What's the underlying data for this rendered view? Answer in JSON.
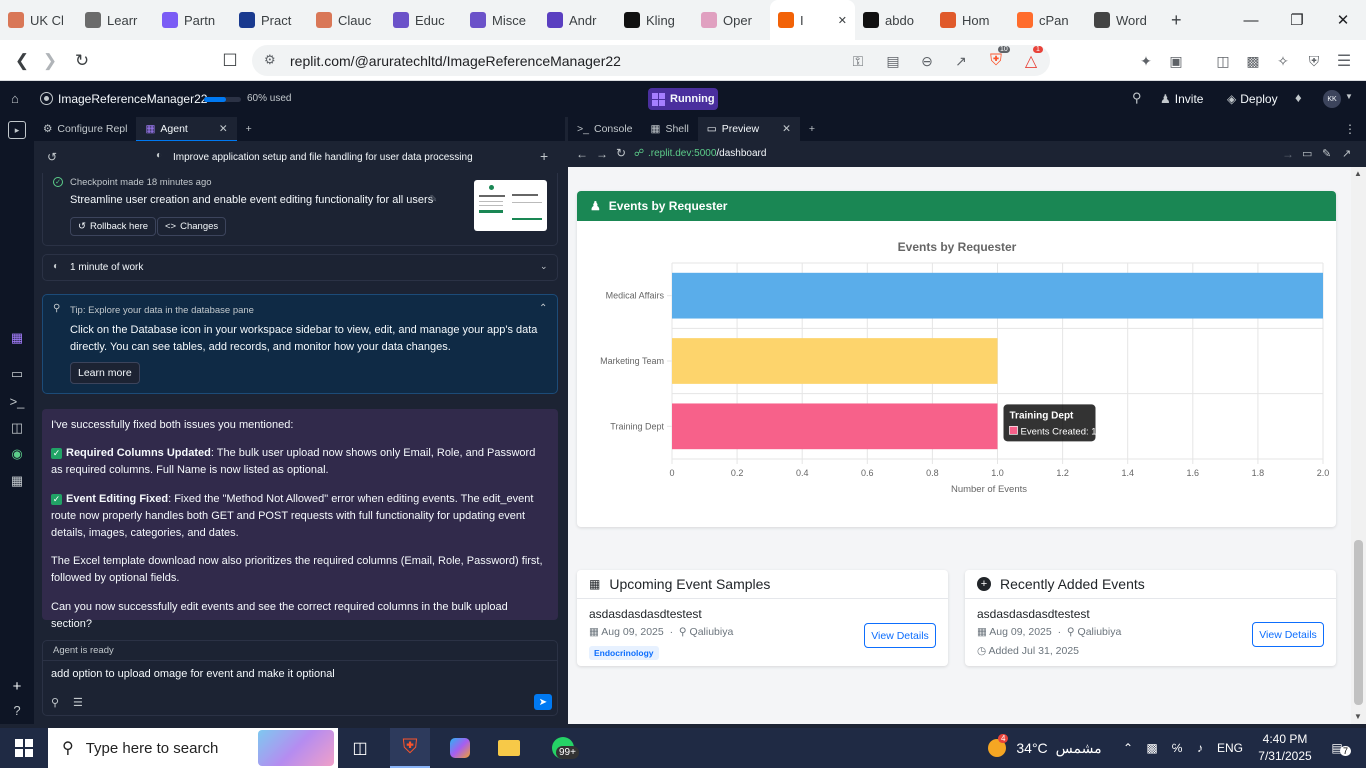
{
  "browser": {
    "tabs": [
      {
        "label": "UK Cl",
        "color": "#d97757"
      },
      {
        "label": "Learr",
        "color": "#6b6b6b"
      },
      {
        "label": "Partn",
        "color": "#7b5cf5"
      },
      {
        "label": "Pract",
        "color": "#1a3a8f"
      },
      {
        "label": "Clauc",
        "color": "#d97757"
      },
      {
        "label": "Educ",
        "color": "#6b52c9"
      },
      {
        "label": "Misce",
        "color": "#6b52c9"
      },
      {
        "label": "Andr",
        "color": "#5a3fc0"
      },
      {
        "label": "Kling",
        "color": "#111111"
      },
      {
        "label": "Oper",
        "color": "#e0a0c0"
      },
      {
        "label": "I",
        "color": "#f26207"
      },
      {
        "label": "abdo",
        "color": "#111111"
      },
      {
        "label": "Hom",
        "color": "#e05a2b"
      },
      {
        "label": "cPan",
        "color": "#ff6c2c"
      },
      {
        "label": "Word",
        "color": "#444444"
      }
    ],
    "active_tab_index": 10,
    "url": "replit.com/@aruratechltd/ImageReferenceManager22",
    "brave_badge": "10",
    "alert_badge": "1"
  },
  "replit": {
    "project_name": "ImageReferenceManager22",
    "usage": "60% used",
    "usage_pct": 60,
    "run_status": "Running",
    "invite": "Invite",
    "deploy": "Deploy",
    "avatar": "KK"
  },
  "left": {
    "tabs": [
      "Configure Repl",
      "Agent"
    ],
    "thread_title": "Improve application setup and file handling for user data processing",
    "checkpoint": {
      "meta": "Checkpoint made 18 minutes ago",
      "title": "Streamline user creation and enable event editing functionality for all users",
      "rollback": "Rollback here",
      "changes": "Changes"
    },
    "work": "1 minute of work",
    "tip": {
      "title": "Tip: Explore your data in the database pane",
      "body": "Click on the Database icon in your workspace sidebar to view, edit, and manage your app's data directly. You can see tables, add records, and monitor how your data changes.",
      "learn_more": "Learn more"
    },
    "message": {
      "intro": "I've successfully fixed both issues you mentioned:",
      "p1_bold": "Required Columns Updated",
      "p1_text": ": The bulk user upload now shows only Email, Role, and Password as required columns. Full Name is now listed as optional.",
      "p2_bold": "Event Editing Fixed",
      "p2_text": ": Fixed the \"Method Not Allowed\" error when editing events. The edit_event route now properly handles both GET and POST requests with full functionality for updating event details, images, categories, and dates.",
      "p3": "The Excel template download now also prioritizes the required columns (Email, Role, Password) first, followed by optional fields.",
      "p4": "Can you now successfully edit events and see the correct required columns in the bulk upload section?"
    },
    "agent_status": "Agent is ready",
    "input_value": "add option to upload omage for event and make it optional"
  },
  "right": {
    "tabs": [
      "Console",
      "Shell",
      "Preview"
    ],
    "preview_url_host": ".replit.dev:5000",
    "preview_url_path": "/dashboard",
    "card_title": "Events by Requester",
    "upcoming_title": "Upcoming Event Samples",
    "recent_title": "Recently Added Events",
    "upcoming_event": {
      "name": "asdasdasdasdtestest",
      "date": "Aug 09, 2025",
      "location": "Qaliubiya",
      "tag": "Endocrinology",
      "button": "View Details"
    },
    "recent_event": {
      "name": "asdasdasdasdtestest",
      "date": "Aug 09, 2025",
      "location": "Qaliubiya",
      "added": "Added Jul 31, 2025",
      "button": "View Details"
    },
    "tooltip": {
      "title": "Training Dept",
      "label": "Events Created: 1"
    }
  },
  "chart_data": {
    "type": "bar",
    "orientation": "horizontal",
    "title": "Events by Requester",
    "xlabel": "Number of Events",
    "ylabel": "",
    "categories": [
      "Medical Affairs",
      "Marketing Team",
      "Training Dept"
    ],
    "values": [
      2,
      1,
      1
    ],
    "colors": [
      "#5aadea",
      "#fdd46c",
      "#f7618a"
    ],
    "xlim": [
      0,
      2
    ],
    "xticks": [
      "0",
      "0.2",
      "0.4",
      "0.6",
      "0.8",
      "1.0",
      "1.2",
      "1.4",
      "1.6",
      "1.8",
      "2.0"
    ],
    "grid": true
  },
  "taskbar": {
    "search_placeholder": "Type here to search",
    "whatsapp_badge": "99+",
    "weather_badge": "4",
    "temperature": "34°C",
    "weather_text": "مشمس",
    "language": "ENG",
    "time": "4:40 PM",
    "date": "7/31/2025",
    "notif_count": "7"
  }
}
